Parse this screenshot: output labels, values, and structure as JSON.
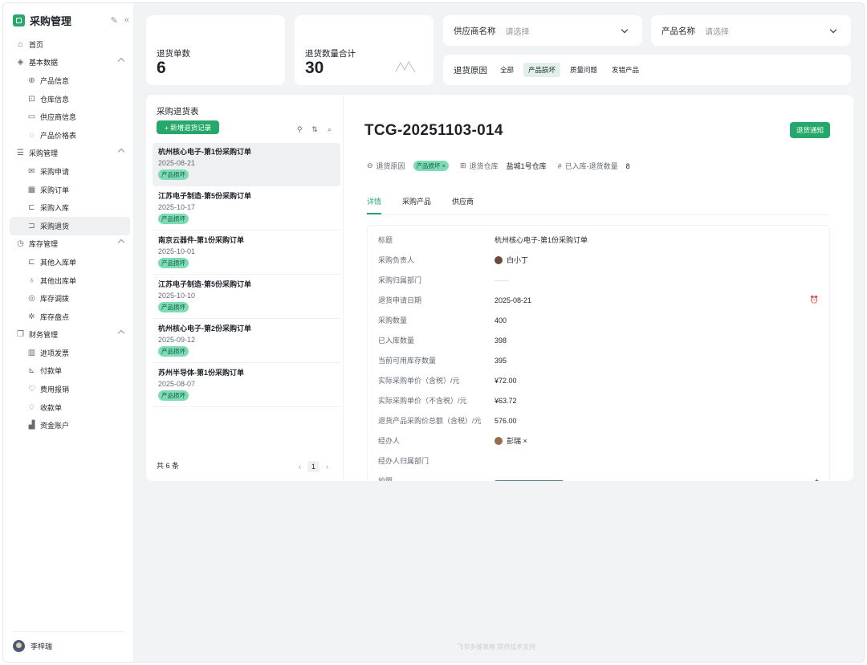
{
  "app": {
    "title": "采购管理"
  },
  "sidebar": {
    "items": [
      {
        "label": "首页",
        "icon": "home-icon"
      },
      {
        "label": "基本数据",
        "icon": "layers-icon"
      },
      {
        "label": "产品信息",
        "icon": "globe-icon"
      },
      {
        "label": "仓库信息",
        "icon": "warehouse-icon"
      },
      {
        "label": "供应商信息",
        "icon": "monitor-icon"
      },
      {
        "label": "产品价格表",
        "icon": "price-icon"
      },
      {
        "label": "采购管理",
        "icon": "list-icon"
      },
      {
        "label": "采购申请",
        "icon": "mail-icon"
      },
      {
        "label": "采购订单",
        "icon": "calendar-icon"
      },
      {
        "label": "采购入库",
        "icon": "inbox-icon"
      },
      {
        "label": "采购退货",
        "icon": "return-icon"
      },
      {
        "label": "库存管理",
        "icon": "clock-icon"
      },
      {
        "label": "其他入库单",
        "icon": "inbound-icon"
      },
      {
        "label": "其他出库单",
        "icon": "outbound-icon"
      },
      {
        "label": "库存调拨",
        "icon": "transfer-icon"
      },
      {
        "label": "库存盘点",
        "icon": "count-icon"
      },
      {
        "label": "财务管理",
        "icon": "copy-icon"
      },
      {
        "label": "进项发票",
        "icon": "barcode-icon"
      },
      {
        "label": "付款单",
        "icon": "payment-icon"
      },
      {
        "label": "费用报销",
        "icon": "expense-icon"
      },
      {
        "label": "收款单",
        "icon": "receipt-icon"
      },
      {
        "label": "资金账户",
        "icon": "chart-bar-icon"
      }
    ],
    "user": "李梓瑞"
  },
  "stats": {
    "count_label": "退货单数",
    "count_value": "6",
    "qty_label": "退货数量合计",
    "qty_value": "30"
  },
  "filters": {
    "supplier_label": "供应商名称",
    "supplier_placeholder": "请选择",
    "product_label": "产品名称",
    "product_placeholder": "请选择",
    "reason_label": "退货原因",
    "reason_chips": [
      "全部",
      "产品损坏",
      "质量问题",
      "发错产品"
    ]
  },
  "list": {
    "title": "采购退货表",
    "new_button": "+ 新增退货记录",
    "records": [
      {
        "title": "杭州核心电子-第1份采购订单",
        "date": "2025-08-21",
        "tag": "产品损坏"
      },
      {
        "title": "江苏电子制造-第5份采购订单",
        "date": "2025-10-17",
        "tag": "产品损坏"
      },
      {
        "title": "南京云器件-第1份采购订单",
        "date": "2025-10-01",
        "tag": "产品损坏"
      },
      {
        "title": "江苏电子制造-第5份采购订单",
        "date": "2025-10-10",
        "tag": "产品损坏"
      },
      {
        "title": "杭州核心电子-第2份采购订单",
        "date": "2025-09-12",
        "tag": "产品损坏"
      },
      {
        "title": "苏州半导体-第1份采购订单",
        "date": "2025-08-07",
        "tag": "产品损坏"
      }
    ],
    "total": "共 6 条",
    "page": "1"
  },
  "detail": {
    "code": "TCG-20251103-014",
    "notify_button": "退货通知",
    "meta": {
      "reason_label": "退货原因",
      "reason_value": "产品损坏 ×",
      "warehouse_label": "退货仓库",
      "warehouse_value": "盐城1号仓库",
      "qty_label": "已入库-退货数量",
      "qty_value": "8"
    },
    "tabs": [
      "详情",
      "采购产品",
      "供应商"
    ],
    "fields": [
      {
        "label": "标题",
        "value": "杭州核心电子-第1份采购订单"
      },
      {
        "label": "采购负责人",
        "value": "白小丁"
      },
      {
        "label": "采购归属部门",
        "value": "——"
      },
      {
        "label": "退货申请日期",
        "value": "2025-08-21"
      },
      {
        "label": "采购数量",
        "value": "400"
      },
      {
        "label": "已入库数量",
        "value": "398"
      },
      {
        "label": "当前可用库存数量",
        "value": "395"
      },
      {
        "label": "实际采购单价（含税）/元",
        "value": "¥72.00"
      },
      {
        "label": "实际采购单价（不含税）/元",
        "value": "¥63.72"
      },
      {
        "label": "退货产品采购价总额（含税）/元",
        "value": "576.00"
      },
      {
        "label": "经办人",
        "value": "彭瑞 ×"
      },
      {
        "label": "经办人归属部门",
        "value": ""
      },
      {
        "label": "拍照",
        "value": ""
      }
    ]
  },
  "footer": "飞书多维表格 提供技术支持"
}
